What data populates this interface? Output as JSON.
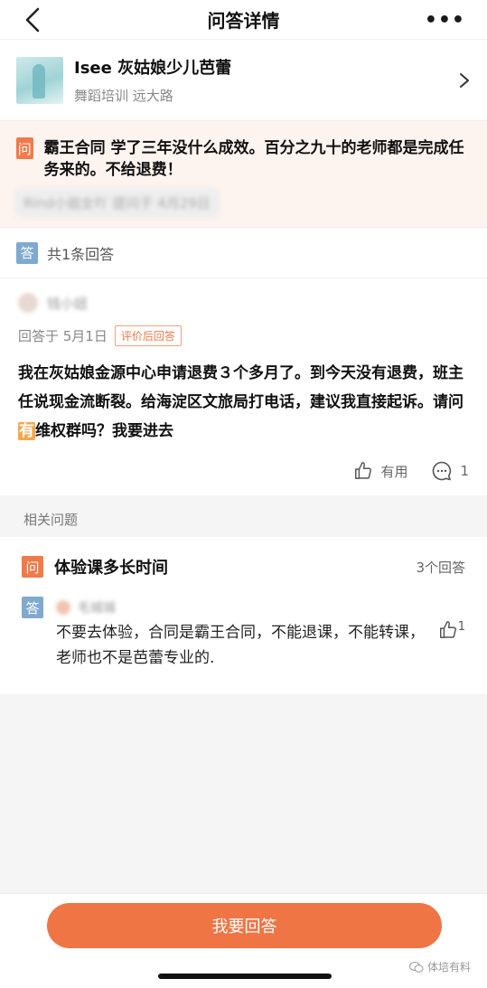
{
  "nav": {
    "title": "问答详情",
    "more": "•••"
  },
  "shop": {
    "name": "Isee 灰姑娘少儿芭蕾",
    "subtitle": "舞蹈培训 远大路"
  },
  "question": {
    "tag": "问",
    "text": "霸王合同 学了三年没什么成效。百分之九十的老师都是完成任务来的。不给退费！",
    "asker_meta": "Rind小姐女吖  提问于 4月29日"
  },
  "answers_header": {
    "tag": "答",
    "count_label": "共1条回答"
  },
  "answer": {
    "user_name": "钱小妞",
    "date_label": "回答于 5月1日",
    "badge": "评价后回答",
    "text_before": "我在灰姑娘金源中心申请退费３个多月了。到今天没有退费，班主任说现金流断裂。给海淀区文旅局打电话，建议我直接起诉。请问",
    "text_highlight": "有",
    "text_after": "维权群吗？我要进去",
    "useful_label": "有用",
    "comment_count": "1"
  },
  "related": {
    "section_label": "相关问题",
    "q_tag": "问",
    "title": "体验课多长时间",
    "answer_count": "3个回答",
    "a_tag": "答",
    "user_name": "毛城城",
    "text": "不要去体验，合同是霸王合同，不能退课，不能转课，老师也不是芭蕾专业的.",
    "like_count": "1"
  },
  "footer": {
    "cta_label": "我要回答",
    "watermark": "体培有料"
  },
  "colors": {
    "accent": "#ef7545",
    "question_bg": "#fdf3ef",
    "answer_tag": "#7fa9cf"
  }
}
